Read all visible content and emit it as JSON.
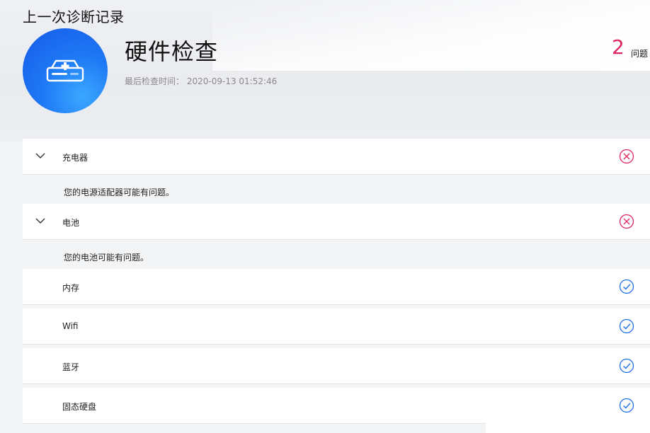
{
  "header": {
    "page_title": "上一次诊断记录",
    "section_title": "硬件检查",
    "last_check_label": "最后检查时间：",
    "last_check_time": "2020-09-13 01:52:46",
    "issue_count": "2",
    "issue_label": "问题"
  },
  "hero": {
    "icon": "hard-drive-icon",
    "color_start": "#1659e6",
    "color_end": "#3aa8ff"
  },
  "colors": {
    "error": "#e0245e",
    "ok": "#1f6fe8"
  },
  "items": [
    {
      "label": "充电器",
      "status": "error",
      "expanded": true,
      "detail": "您的电源适配器可能有问题。"
    },
    {
      "label": "电池",
      "status": "error",
      "expanded": true,
      "detail": "您的电池可能有问题。"
    },
    {
      "label": "内存",
      "status": "ok"
    },
    {
      "label": "Wifi",
      "status": "ok"
    },
    {
      "label": "蓝牙",
      "status": "ok"
    },
    {
      "label": "固态硬盘",
      "status": "ok"
    }
  ]
}
